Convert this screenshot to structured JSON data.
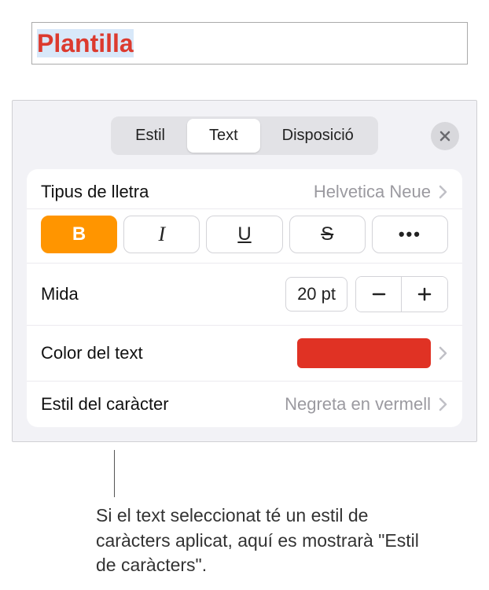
{
  "textbox": {
    "content": "Plantilla"
  },
  "tabs": {
    "estil": "Estil",
    "text": "Text",
    "disposicio": "Disposició"
  },
  "font": {
    "label": "Tipus de lletra",
    "value": "Helvetica Neue"
  },
  "format": {
    "bold": "B",
    "italic": "I",
    "underline": "U",
    "strike": "S",
    "more": "•••"
  },
  "size": {
    "label": "Mida",
    "value": "20 pt"
  },
  "color": {
    "label": "Color del text",
    "value": "#e03224"
  },
  "charstyle": {
    "label": "Estil del caràcter",
    "value": "Negreta en vermell"
  },
  "callout": "Si el text seleccionat té un estil de caràcters aplicat, aquí es mostrarà \"Estil de caràcters\"."
}
